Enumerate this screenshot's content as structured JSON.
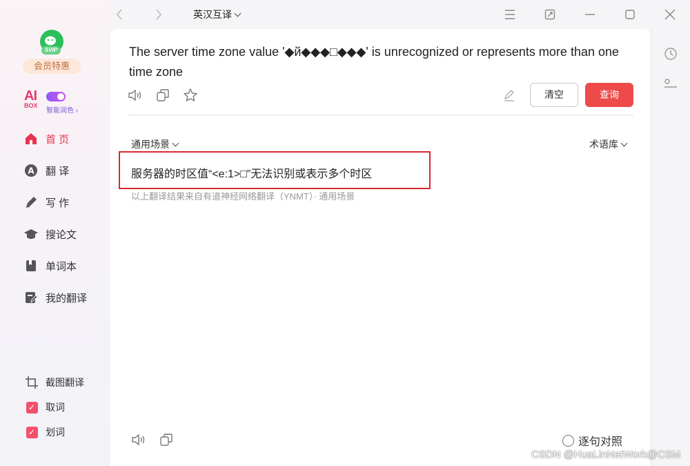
{
  "sidebar": {
    "svip_badge": "SVIP",
    "member_label": "会员特惠",
    "aibox": {
      "ai": "AI",
      "box": "BOX",
      "label": "智能润色 ›"
    },
    "nav": [
      {
        "label": "首 页",
        "icon": "home-icon"
      },
      {
        "label": "翻 译",
        "icon": "translate-icon"
      },
      {
        "label": "写 作",
        "icon": "pen-icon"
      },
      {
        "label": "搜论文",
        "icon": "graduation-cap-icon"
      },
      {
        "label": "单词本",
        "icon": "bookmark-icon"
      },
      {
        "label": "我的翻译",
        "icon": "document-edit-icon"
      }
    ],
    "tools": [
      {
        "label": "截图翻译",
        "icon": "crop-icon"
      },
      {
        "label": "取词",
        "icon": "checkbox-checked-icon"
      },
      {
        "label": "划词",
        "icon": "checkbox-checked-icon"
      }
    ],
    "accent": "#e8334d"
  },
  "titlebar": {
    "language": "英汉互译"
  },
  "source": {
    "text": "The server time zone value '◆й◆◆◆□◆◆◆' is unrecognized or represents more than one time zone"
  },
  "buttons": {
    "clear": "清空",
    "query": "查询",
    "query_color": "#ef4a4a"
  },
  "result": {
    "scene": "通用场景",
    "term_library": "术语库",
    "text": "服务器的时区值“<e:1>□”无法识别或表示多个时区",
    "note": "以上翻译结果来自有道神经网络翻译（YNMT）· 通用场景",
    "align_option": "逐句对照"
  },
  "watermark": "CSDN @HuaLinNetWork@CSM"
}
